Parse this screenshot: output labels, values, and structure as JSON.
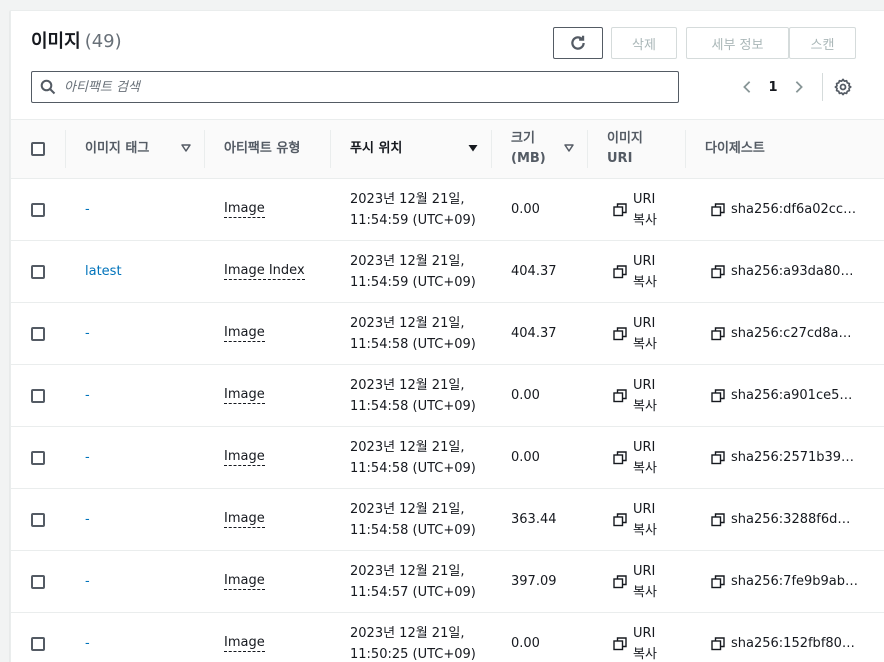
{
  "header": {
    "title": "이미지",
    "count": "(49)",
    "buttons": {
      "delete": "삭제",
      "details": "세부 정보",
      "scan": "스캔"
    }
  },
  "search": {
    "placeholder": "아티팩트 검색",
    "value": ""
  },
  "pagination": {
    "current_page": "1"
  },
  "columns": {
    "tag": "이미지 태그",
    "type": "아티팩트 유형",
    "push": "푸시 위치",
    "size_line1": "크기",
    "size_line2": "(MB)",
    "uri_line1": "이미지",
    "uri_line2": "URI",
    "digest": "다이제스트"
  },
  "rows": [
    {
      "tag": "-",
      "type": "Image",
      "push_date": "2023년 12월 21일,",
      "push_time": "11:54:59 (UTC+09)",
      "size": "0.00",
      "uri_1": "URI",
      "uri_2": "복사",
      "digest": "sha256:df6a02cc…"
    },
    {
      "tag": "latest",
      "type": "Image Index",
      "push_date": "2023년 12월 21일,",
      "push_time": "11:54:59 (UTC+09)",
      "size": "404.37",
      "uri_1": "URI",
      "uri_2": "복사",
      "digest": "sha256:a93da80…"
    },
    {
      "tag": "-",
      "type": "Image",
      "push_date": "2023년 12월 21일,",
      "push_time": "11:54:58 (UTC+09)",
      "size": "404.37",
      "uri_1": "URI",
      "uri_2": "복사",
      "digest": "sha256:c27cd8ae…"
    },
    {
      "tag": "-",
      "type": "Image",
      "push_date": "2023년 12월 21일,",
      "push_time": "11:54:58 (UTC+09)",
      "size": "0.00",
      "uri_1": "URI",
      "uri_2": "복사",
      "digest": "sha256:a901ce5…"
    },
    {
      "tag": "-",
      "type": "Image",
      "push_date": "2023년 12월 21일,",
      "push_time": "11:54:58 (UTC+09)",
      "size": "0.00",
      "uri_1": "URI",
      "uri_2": "복사",
      "digest": "sha256:2571b39…"
    },
    {
      "tag": "-",
      "type": "Image",
      "push_date": "2023년 12월 21일,",
      "push_time": "11:54:58 (UTC+09)",
      "size": "363.44",
      "uri_1": "URI",
      "uri_2": "복사",
      "digest": "sha256:3288f6d…"
    },
    {
      "tag": "-",
      "type": "Image",
      "push_date": "2023년 12월 21일,",
      "push_time": "11:54:57 (UTC+09)",
      "size": "397.09",
      "uri_1": "URI",
      "uri_2": "복사",
      "digest": "sha256:7fe9b9ab…"
    },
    {
      "tag": "-",
      "type": "Image",
      "push_date": "2023년 12월 21일,",
      "push_time": "11:50:25 (UTC+09)",
      "size": "0.00",
      "uri_1": "URI",
      "uri_2": "복사",
      "digest": "sha256:152fbf80…"
    }
  ],
  "icons": {
    "refresh": "refresh-icon",
    "search": "search-icon",
    "prev": "chevron-left-icon",
    "next": "chevron-right-icon",
    "settings": "gear-icon",
    "copy": "copy-icon",
    "sort": "caret-down-icon"
  },
  "colors": {
    "link": "#0073bb",
    "border": "#545b64",
    "disabled": "#aab7b8"
  }
}
